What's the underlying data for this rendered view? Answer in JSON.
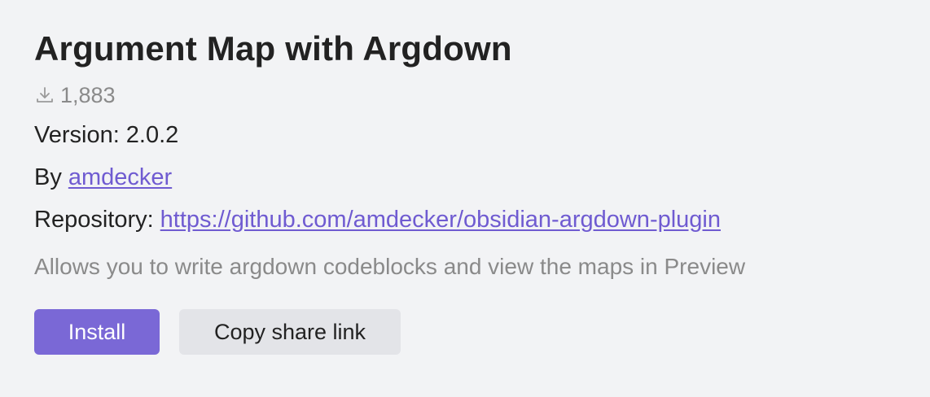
{
  "plugin": {
    "title": "Argument Map with Argdown",
    "downloads": "1,883",
    "version_label": "Version:",
    "version": "2.0.2",
    "author_label": "By",
    "author": "amdecker",
    "repository_label": "Repository:",
    "repository_url": "https://github.com/amdecker/obsidian-argdown-plugin",
    "description": "Allows you to write argdown codeblocks and view the maps in Preview"
  },
  "actions": {
    "install_label": "Install",
    "copy_link_label": "Copy share link"
  },
  "icons": {
    "downloads": "download-icon"
  },
  "colors": {
    "accent": "#7a68d6",
    "link": "#6f5bd1",
    "muted_text": "#8a8a8a",
    "background": "#f2f3f5"
  }
}
